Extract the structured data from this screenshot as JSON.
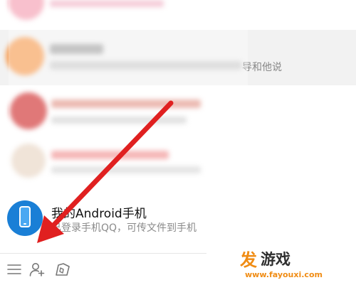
{
  "conversations": [
    {
      "id": "blurred-1"
    },
    {
      "id": "blurred-2",
      "message_tail": "导和他说"
    },
    {
      "id": "blurred-3"
    },
    {
      "id": "blurred-4"
    },
    {
      "id": "my-android-phone",
      "title": "我的Android手机",
      "subtitle": "已登录手机QQ，可传文件到手机",
      "icon": "phone-icon"
    }
  ],
  "toolbar": {
    "menu_icon": "menu-icon",
    "add_contact_icon": "add-contact-icon",
    "apps_icon": "apps-icon"
  },
  "watermark": {
    "logo_char": "发",
    "name": "游戏",
    "url": "www.fayouxi.com"
  },
  "colors": {
    "accent_blue": "#1a7fd6",
    "arrow_red": "#e02020",
    "selected_row_bg": "#f2f2f2",
    "watermark_orange": "#f08c14"
  }
}
